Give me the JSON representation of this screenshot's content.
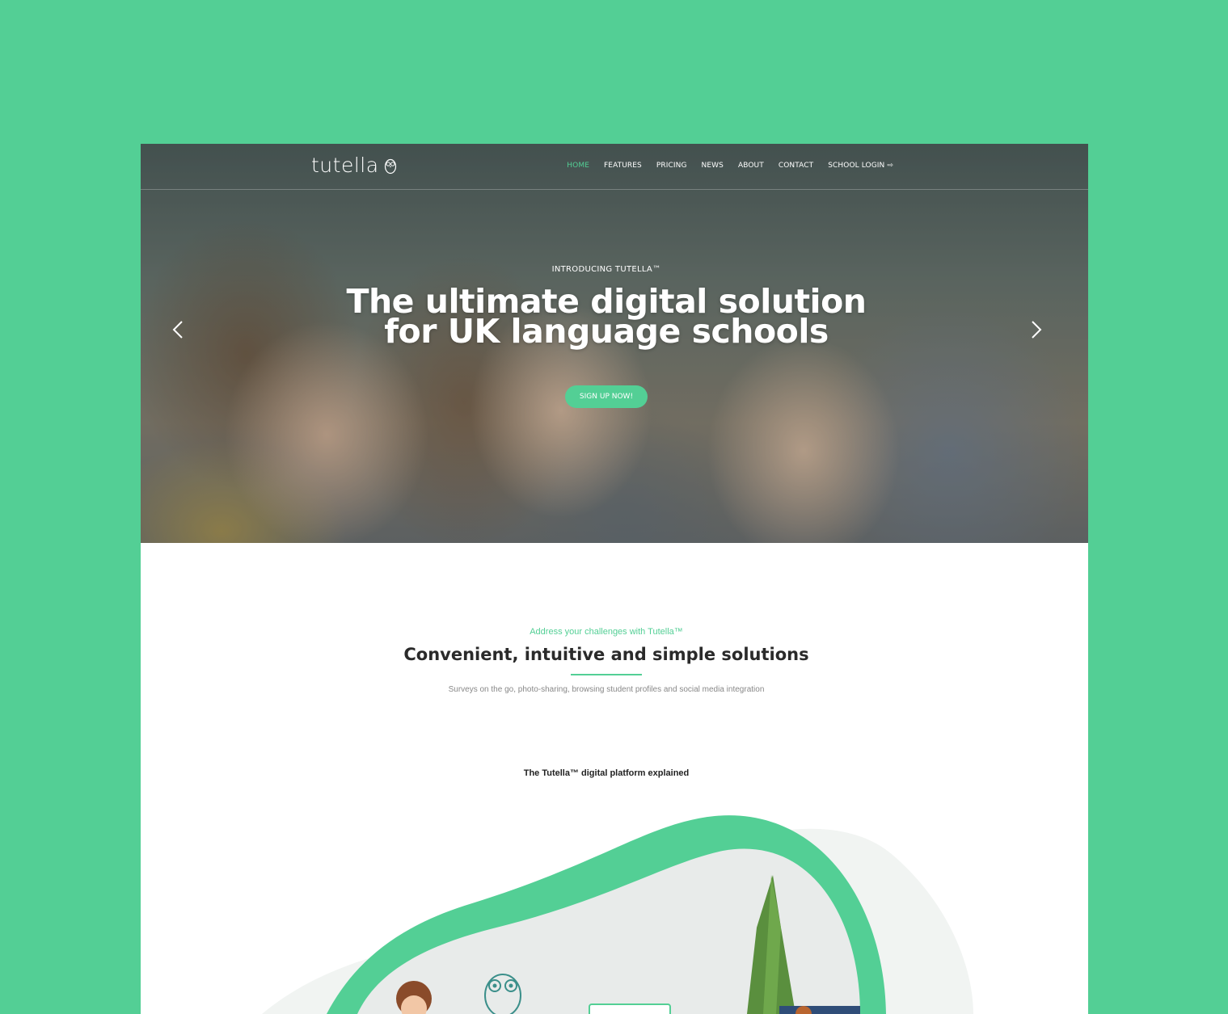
{
  "brand": {
    "logo_text": "tutella"
  },
  "nav": {
    "items": [
      {
        "label": "HOME",
        "active": true
      },
      {
        "label": "FEATURES",
        "active": false
      },
      {
        "label": "PRICING",
        "active": false
      },
      {
        "label": "NEWS",
        "active": false
      },
      {
        "label": "ABOUT",
        "active": false
      },
      {
        "label": "CONTACT",
        "active": false
      },
      {
        "label": "SCHOOL LOGIN",
        "active": false
      }
    ]
  },
  "hero": {
    "eyebrow": "INTRODUCING TUTELLA™",
    "headline_line1": "The ultimate digital solution",
    "headline_line2": "for UK language schools",
    "cta_label": "SIGN UP NOW!"
  },
  "intro": {
    "kicker": "Address your challenges with Tutella™",
    "title": "Convenient, intuitive and simple solutions",
    "subtitle": "Surveys on the go, photo-sharing, browsing student profiles and social media integration"
  },
  "platform": {
    "heading": "The Tutella™ digital platform explained"
  },
  "colors": {
    "accent": "#53cf95",
    "background": "#53cf95"
  },
  "icons": {
    "prev": "chevron-left-icon",
    "next": "chevron-right-icon",
    "login": "sign-in-icon"
  }
}
